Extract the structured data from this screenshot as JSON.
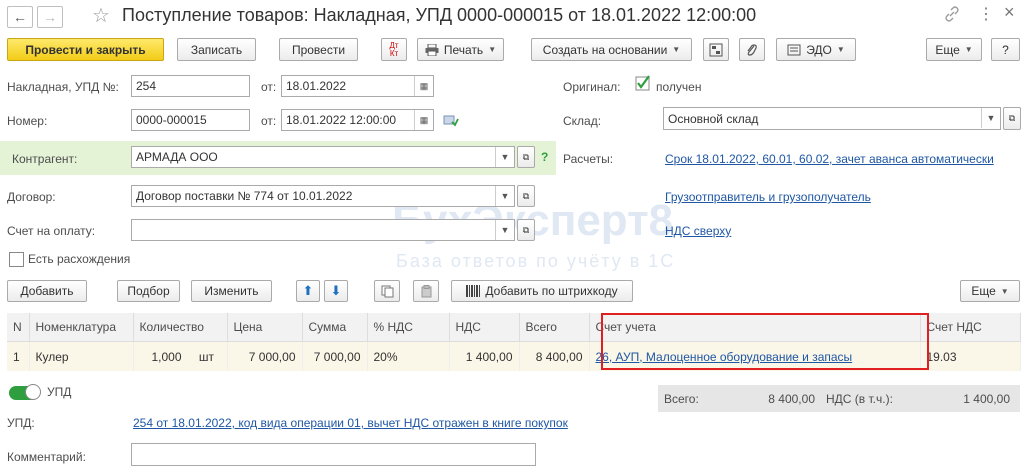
{
  "header": {
    "title": "Поступление товаров: Накладная, УПД 0000-000015 от 18.01.2022 12:00:00",
    "back_icon": "←",
    "forward_icon": "→",
    "star_icon": "☆",
    "link_icon": "🔗",
    "more_icon": "⋮",
    "close_icon": "×"
  },
  "toolbar": {
    "post_close": "Провести и закрыть",
    "save": "Записать",
    "post": "Провести",
    "dt_kt": "Дт\nКт",
    "print": "Печать",
    "create_based": "Создать на основании",
    "edo": "ЭДО",
    "more": "Еще",
    "help": "?"
  },
  "form": {
    "invoice_label": "Накладная, УПД №:",
    "invoice_value": "254",
    "from_label1": "от:",
    "date1": "18.01.2022",
    "original_label": "Оригинал:",
    "original_value": "получен",
    "number_label": "Номер:",
    "number_value": "0000-000015",
    "from_label2": "от:",
    "date2": "18.01.2022 12:00:00",
    "warehouse_label": "Склад:",
    "warehouse_value": "Основной склад",
    "counterparty_label": "Контрагент:",
    "counterparty_value": "АРМАДА ООО",
    "settlements_label": "Расчеты:",
    "settlements_link": "Срок 18.01.2022, 60.01, 60.02, зачет аванса автоматически",
    "contract_label": "Договор:",
    "contract_value": "Договор поставки № 774 от 10.01.2022",
    "shipper_link": "Грузоотправитель и грузополучатель",
    "invoice_pay_label": "Счет на оплату:",
    "invoice_pay_value": "",
    "vat_link": "НДС сверху",
    "discrepancy_label": "Есть расхождения"
  },
  "table_toolbar": {
    "add": "Добавить",
    "pick": "Подбор",
    "change": "Изменить",
    "up": "⬆",
    "down": "⬇",
    "barcode": "Добавить по штрихкоду",
    "more": "Еще"
  },
  "table": {
    "columns": [
      "N",
      "Номенклатура",
      "Количество",
      "Цена",
      "Сумма",
      "% НДС",
      "НДС",
      "Всего",
      "Счет учета",
      "Счет НДС"
    ],
    "rows": [
      {
        "n": "1",
        "item": "Кулер",
        "qty": "1,000",
        "unit": "шт",
        "price": "7 000,00",
        "sum": "7 000,00",
        "vat_rate": "20%",
        "vat": "1 400,00",
        "total": "8 400,00",
        "account": "26, АУП, Малоценное оборудование и запасы",
        "vat_account": "19.03"
      }
    ]
  },
  "footer": {
    "upd_toggle_label": "УПД",
    "upd_label": "УПД:",
    "upd_link": "254 от 18.01.2022, код вида операции 01, вычет НДС отражен в книге покупок",
    "comment_label": "Комментарий:",
    "comment_value": "",
    "total_label": "Всего:",
    "total_value": "8 400,00",
    "vat_label": "НДС (в т.ч.):",
    "vat_value": "1 400,00"
  },
  "watermark": {
    "brand": "БухЭксперт8",
    "tagline": "База ответов по учёту в 1С"
  },
  "colors": {
    "primary_button": "#f2cc17",
    "link": "#1f57a4",
    "highlight_frame": "#e02020",
    "counterparty_band": "#e4f2d6",
    "toggle": "#2e9e3e"
  }
}
